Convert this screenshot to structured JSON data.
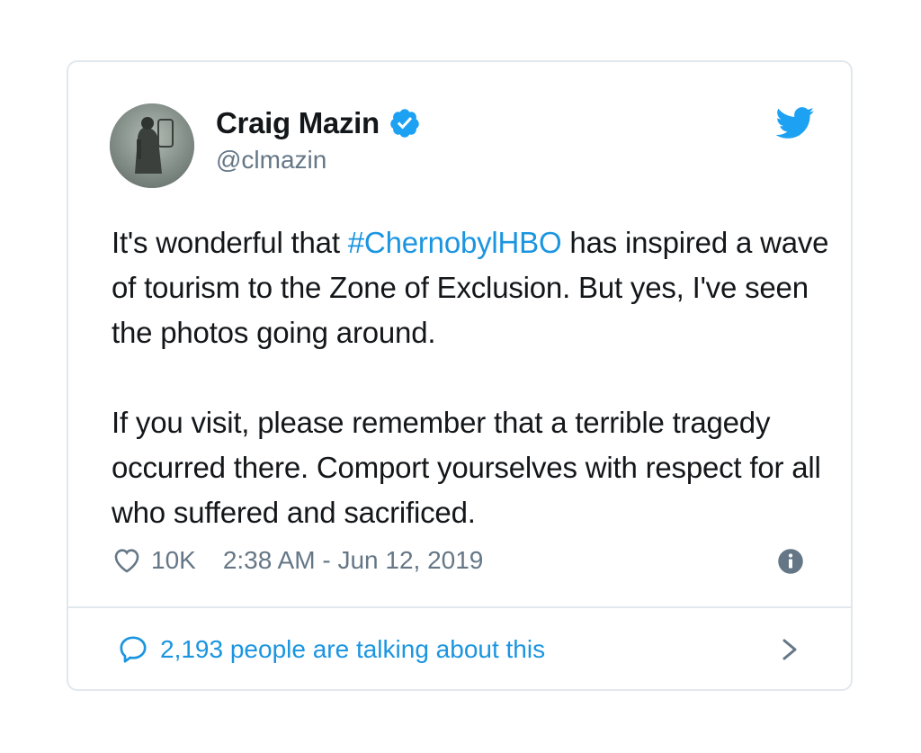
{
  "tweet": {
    "display_name": "Craig Mazin",
    "handle": "@clmazin",
    "text_part1": "It's wonderful that ",
    "hashtag": "#ChernobylHBO",
    "text_part2": " has inspired a wave of tourism to the Zone of Exclusion. But yes, I've seen the photos going around.",
    "paragraph2": "If you visit, please remember that a terrible tragedy occurred there. Comport yourselves with respect for all who suffered and sacrificed.",
    "likes": "10K",
    "timestamp": "2:38 AM - Jun 12, 2019",
    "talking": "2,193 people are talking about this"
  },
  "icons": {
    "avatar": "avatar-photo",
    "verified": "verified-badge-icon",
    "brand": "twitter-bird-icon",
    "like": "heart-icon",
    "info": "info-icon",
    "reply": "speech-bubble-icon",
    "more": "chevron-right-icon"
  },
  "colors": {
    "accent": "#1b95e0",
    "text": "#14171a",
    "muted": "#657786",
    "border": "#e1e8ed"
  }
}
